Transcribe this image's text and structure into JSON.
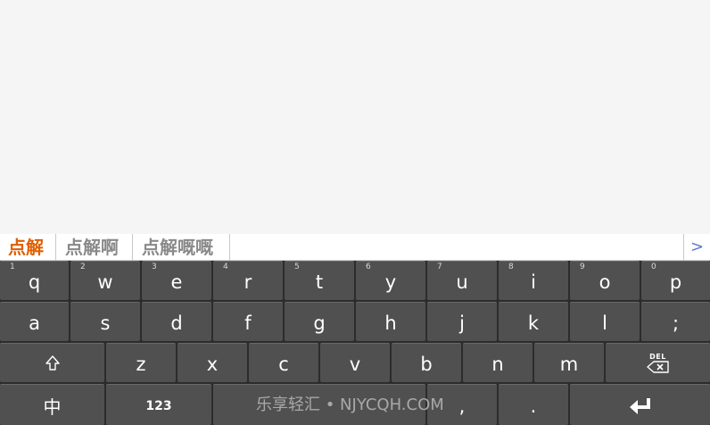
{
  "candidates": [
    "点解",
    "点解啊",
    "点解嘅嘅"
  ],
  "more_label": ">",
  "rows": {
    "row1": [
      {
        "label": "q",
        "hint": "1"
      },
      {
        "label": "w",
        "hint": "2"
      },
      {
        "label": "e",
        "hint": "3"
      },
      {
        "label": "r",
        "hint": "4"
      },
      {
        "label": "t",
        "hint": "5"
      },
      {
        "label": "y",
        "hint": "6"
      },
      {
        "label": "u",
        "hint": "7"
      },
      {
        "label": "i",
        "hint": "8"
      },
      {
        "label": "o",
        "hint": "9"
      },
      {
        "label": "p",
        "hint": "0"
      }
    ],
    "row2": [
      {
        "label": "a"
      },
      {
        "label": "s"
      },
      {
        "label": "d"
      },
      {
        "label": "f"
      },
      {
        "label": "g"
      },
      {
        "label": "h"
      },
      {
        "label": "j"
      },
      {
        "label": "k"
      },
      {
        "label": "l"
      },
      {
        "label": ";"
      }
    ],
    "row3": [
      {
        "label": "z"
      },
      {
        "label": "x"
      },
      {
        "label": "c"
      },
      {
        "label": "v"
      },
      {
        "label": "b"
      },
      {
        "label": "n"
      },
      {
        "label": "m"
      }
    ]
  },
  "keys": {
    "shift_icon": "shift-arrow-icon",
    "delete_label": "DEL",
    "delete_icon": "backspace-icon",
    "lang_label": "中",
    "numbers_label": "123",
    "comma_label": ",",
    "period_label": ".",
    "enter_icon": "enter-arrow-icon"
  },
  "watermark": "乐享轻汇 • NJYCQH.COM"
}
